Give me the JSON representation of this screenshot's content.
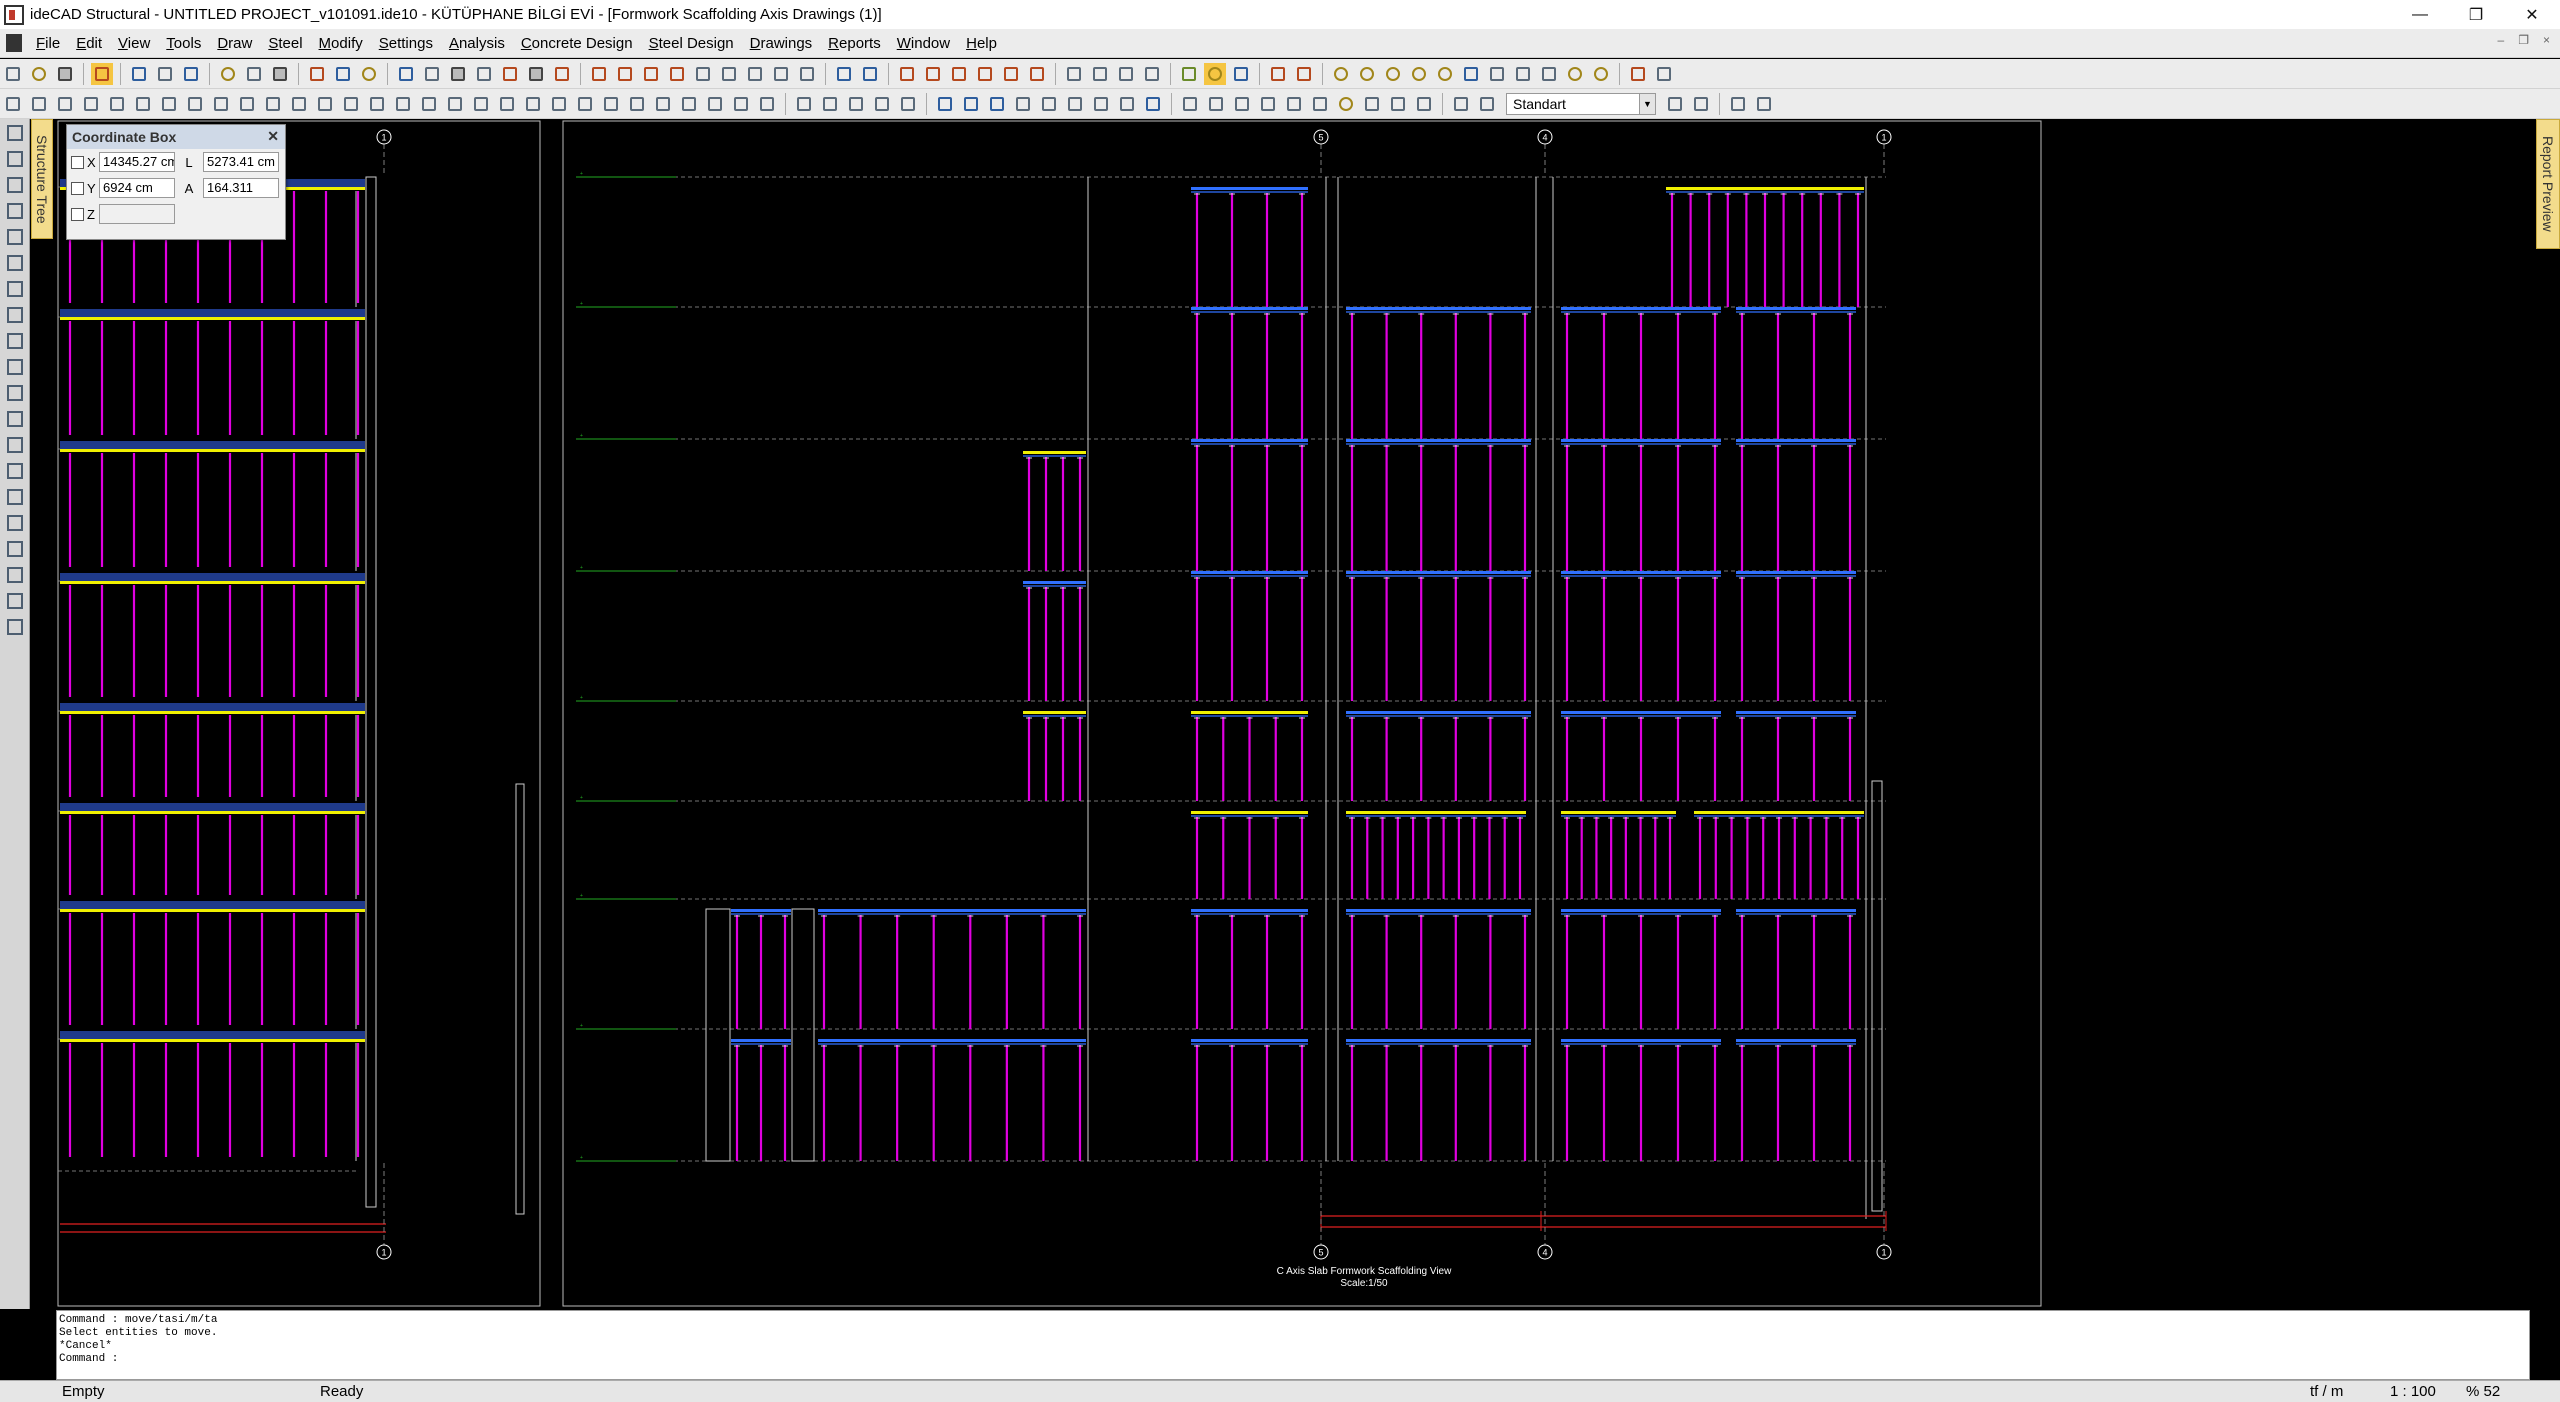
{
  "window": {
    "title": "ideCAD Structural - UNTITLED PROJECT_v101091.ide10 - KÜTÜPHANE BİLGİ EVİ - [Formwork Scaffolding Axis Drawings (1)]",
    "minimize_icon": "minimize-icon",
    "restore_icon": "restore-icon",
    "close_icon": "close-icon"
  },
  "menu": {
    "items": [
      "File",
      "Edit",
      "View",
      "Tools",
      "Draw",
      "Steel",
      "Modify",
      "Settings",
      "Analysis",
      "Concrete Design",
      "Steel Design",
      "Drawings",
      "Reports",
      "Window",
      "Help"
    ]
  },
  "toolbar": {
    "style_select": "Standart"
  },
  "side_tabs": {
    "structure_tree": "Structure Tree",
    "report_preview": "Report Preview"
  },
  "coordinate_box": {
    "title": "Coordinate Box",
    "x_label": "X",
    "x_value": "14345.27 cm",
    "y_label": "Y",
    "y_value": "6924 cm",
    "z_label": "Z",
    "z_value": "",
    "l_label": "L",
    "l_value": "5273.41 cm",
    "a_label": "A",
    "a_value": "164.311"
  },
  "drawing": {
    "view_title": "C Axis Slab Formwork Scaffolding View",
    "view_scale": "Scale:1/50",
    "axis_labels_top": [
      "1",
      "5",
      "4",
      "1"
    ],
    "axis_labels_bottom": [
      "1",
      "5",
      "4",
      "1"
    ],
    "colors": {
      "support": "#e000e0",
      "slab": "#f0f000",
      "beam": "#3070ff",
      "level": "#22aa22",
      "frame": "#ffffff",
      "dim": "#e02020"
    }
  },
  "command": {
    "lines": [
      "Command : move/tasi/m/ta",
      "Select entities to move.",
      "*Cancel*",
      "Command :"
    ]
  },
  "status": {
    "left": "Empty",
    "mode": "Ready",
    "unit": "tf / m",
    "scale": "1 : 100",
    "zoom": "% 52"
  }
}
